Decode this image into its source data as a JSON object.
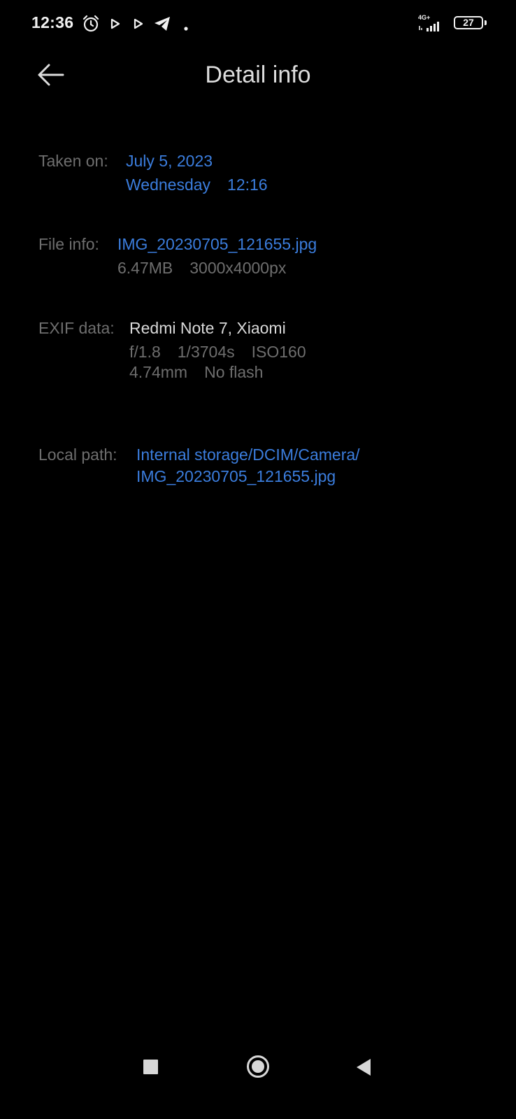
{
  "status_bar": {
    "time": "12:36",
    "network": "4G+",
    "battery": "27",
    "icons": [
      "alarm-icon",
      "play-icon",
      "play-icon",
      "telegram-icon",
      "dot-icon",
      "signal-icon",
      "battery-icon"
    ]
  },
  "header": {
    "title": "Detail info",
    "back_icon": "arrow-left-icon"
  },
  "taken_on": {
    "label": "Taken on:",
    "date": "July 5, 2023",
    "day": "Wednesday",
    "time": "12:16"
  },
  "file_info": {
    "label": "File info:",
    "file_name": "IMG_20230705_121655.jpg",
    "size": "6.47MB",
    "resolution": "3000x4000px"
  },
  "exif": {
    "label": "EXIF data:",
    "device": "Redmi Note 7, Xiaomi",
    "aperture": "f/1.8",
    "shutter": "1/3704s",
    "iso": "ISO160",
    "focal_length": "4.74mm",
    "flash": "No flash"
  },
  "local_path": {
    "label": "Local path:",
    "line1": "Internal storage/DCIM/Camera/",
    "line2": "IMG_20230705_121655.jpg"
  },
  "nav_bar": {
    "buttons": [
      "recents-square-icon",
      "home-circle-icon",
      "back-triangle-icon"
    ]
  },
  "colors": {
    "background": "#000000",
    "link": "#3b7ddd",
    "label": "#6e6e6e",
    "primary_text": "#d9d9d9"
  }
}
